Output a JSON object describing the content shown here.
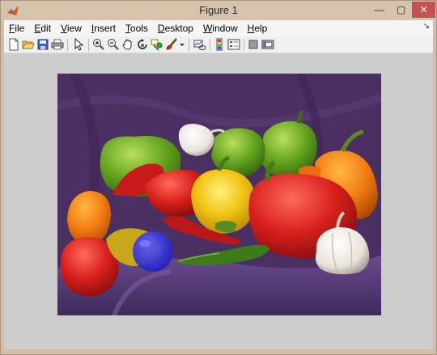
{
  "window": {
    "title": "Figure 1"
  },
  "titlebar_buttons": {
    "minimize": "—",
    "maximize": "▢",
    "close": "✕"
  },
  "menu": [
    {
      "pre": "",
      "mn": "F",
      "post": "ile"
    },
    {
      "pre": "",
      "mn": "E",
      "post": "dit"
    },
    {
      "pre": "",
      "mn": "V",
      "post": "iew"
    },
    {
      "pre": "",
      "mn": "I",
      "post": "nsert"
    },
    {
      "pre": "",
      "mn": "T",
      "post": "ools"
    },
    {
      "pre": "",
      "mn": "D",
      "post": "esktop"
    },
    {
      "pre": "",
      "mn": "W",
      "post": "indow"
    },
    {
      "pre": "",
      "mn": "H",
      "post": "elp"
    }
  ],
  "menu_overflow_icon": "arrow-icon",
  "toolbar_icons": [
    "new-figure-icon",
    "open-file-icon",
    "save-icon",
    "print-icon",
    "edit-plot-icon",
    "zoom-in-icon",
    "zoom-out-icon",
    "pan-icon",
    "rotate-3d-icon",
    "data-cursor-icon",
    "brush-icon",
    "link-plot-icon",
    "insert-colorbar-icon",
    "insert-legend-icon",
    "hide-plot-tools-icon",
    "show-plot-tools-icon"
  ],
  "image": {
    "subject": "peppers",
    "background": "#4a2f63",
    "overlay_marker_color": "#2c2cd8"
  }
}
